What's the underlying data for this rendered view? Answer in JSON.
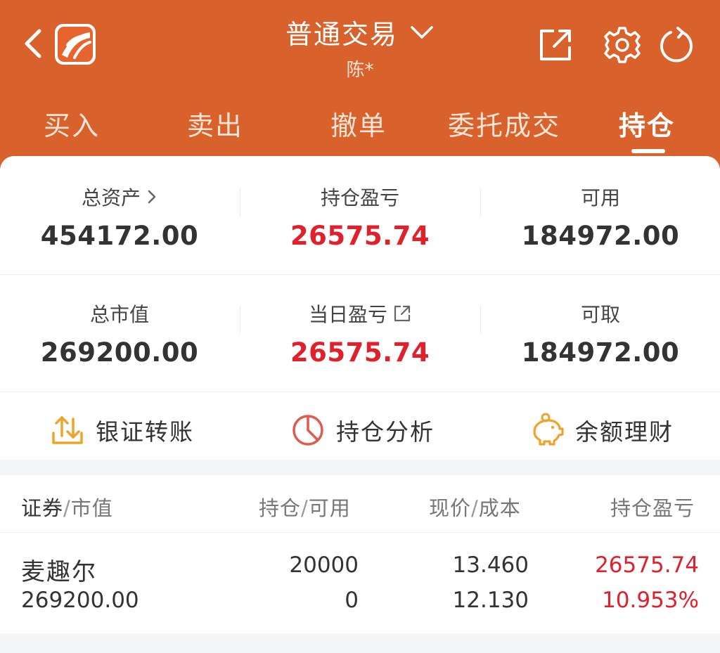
{
  "header": {
    "title": "普通交易",
    "subtitle": "陈*",
    "icons": [
      "back-icon",
      "app-logo",
      "chevron-down-icon",
      "share-icon",
      "gear-icon",
      "refresh-icon"
    ],
    "background_color": "#d9612b"
  },
  "tabs": [
    {
      "label": "买入",
      "active": false
    },
    {
      "label": "卖出",
      "active": false
    },
    {
      "label": "撤单",
      "active": false
    },
    {
      "label": "委托成交",
      "active": false
    },
    {
      "label": "持仓",
      "active": true
    }
  ],
  "summary": {
    "total_assets": {
      "label": "总资产",
      "value": "454172.00"
    },
    "position_pnl": {
      "label": "持仓盈亏",
      "value": "26575.74"
    },
    "available": {
      "label": "可用",
      "value": "184972.00"
    },
    "market_value": {
      "label": "总市值",
      "value": "269200.00"
    },
    "daily_pnl": {
      "label": "当日盈亏",
      "value": "26575.74"
    },
    "withdrawable": {
      "label": "可取",
      "value": "184972.00"
    }
  },
  "shortcuts": [
    {
      "label": "银证转账",
      "icon": "transfer-icon"
    },
    {
      "label": "持仓分析",
      "icon": "pie-chart-icon"
    },
    {
      "label": "余额理财",
      "icon": "piggy-bank-icon"
    }
  ],
  "holdings": {
    "columns": {
      "c1a": "证券",
      "c1b": "市值",
      "c2a": "持仓",
      "c2b": "可用",
      "c3a": "现价",
      "c3b": "成本",
      "c4": "持仓盈亏"
    },
    "rows": [
      {
        "name": "麦趣尔",
        "market_value": "269200.00",
        "position": "20000",
        "available": "0",
        "price": "13.460",
        "cost": "12.130",
        "pnl": "26575.74",
        "pnl_pct": "10.953%"
      }
    ]
  },
  "colors": {
    "accent": "#d9612b",
    "profit_red": "#e0202a",
    "icon_orange": "#f0a32a",
    "icon_red": "#e05a4e"
  }
}
